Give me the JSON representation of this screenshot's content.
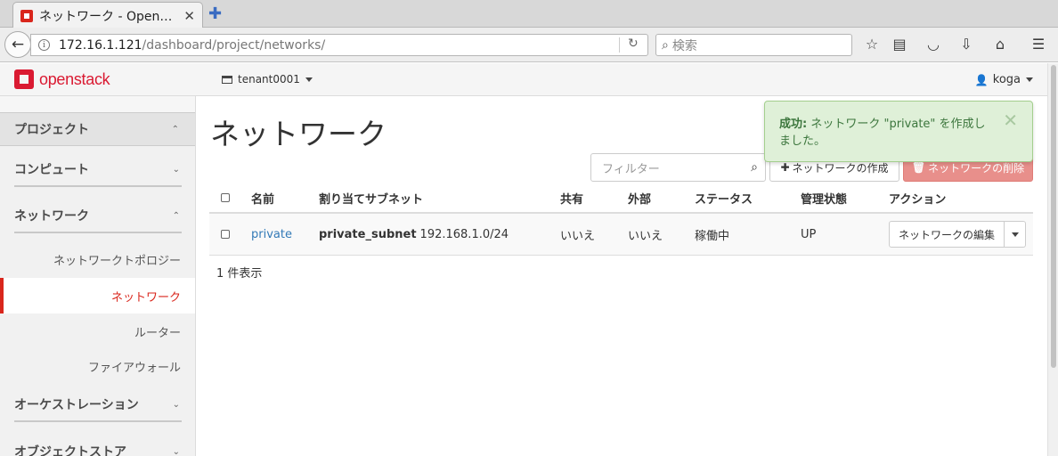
{
  "browser": {
    "tab_title": "ネットワーク - Open…",
    "tab_close": "✕",
    "new_tab": "✚",
    "url_host": "172.16.1.121",
    "url_path": "/dashboard/project/networks/",
    "search_placeholder": "検索"
  },
  "header": {
    "brand": "openstack",
    "tenant": "tenant0001",
    "user": "koga"
  },
  "sidebar": {
    "project": "プロジェクト",
    "compute": "コンピュート",
    "network": "ネットワーク",
    "items": [
      "ネットワークトポロジー",
      "ネットワーク",
      "ルーター",
      "ファイアウォール"
    ],
    "orchestration": "オーケストレーション",
    "object_store": "オブジェクトストア"
  },
  "main": {
    "title": "ネットワーク",
    "filter_placeholder": "フィルター",
    "create_button": "ネットワークの作成",
    "delete_button": "ネットワークの削除",
    "columns": {
      "name": "名前",
      "subnets": "割り当てサブネット",
      "shared": "共有",
      "external": "外部",
      "status": "ステータス",
      "admin_state": "管理状態",
      "actions": "アクション"
    },
    "rows": [
      {
        "name": "private",
        "subnet_name": "private_subnet",
        "subnet_cidr": "192.168.1.0/24",
        "shared": "いいえ",
        "external": "いいえ",
        "status": "稼働中",
        "admin_state": "UP",
        "action": "ネットワークの編集"
      }
    ],
    "count": "1 件表示"
  },
  "alert": {
    "label": "成功:",
    "message": "ネットワーク \"private\" を作成しました。",
    "close": "✕"
  }
}
